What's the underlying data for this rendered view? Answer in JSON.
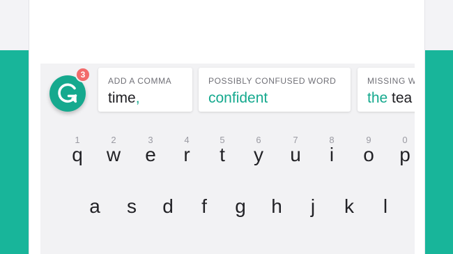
{
  "grammarly": {
    "logo_letter": "G",
    "badge_count": "3",
    "brand_color": "#15a98e",
    "badge_color": "#f26b6b"
  },
  "suggestions": [
    {
      "title": "ADD A COMMA",
      "text_before": "time",
      "accent": ",",
      "text_after": ""
    },
    {
      "title": "POSSIBLY CONFUSED WORD",
      "text_before": "",
      "accent": "confident",
      "text_after": ""
    },
    {
      "title": "MISSING W",
      "text_before": "",
      "accent": "the",
      "text_after": " tea"
    }
  ],
  "keyboard": {
    "digits": [
      "1",
      "2",
      "3",
      "4",
      "5",
      "6",
      "7",
      "8",
      "9",
      "0"
    ],
    "row1": [
      "q",
      "w",
      "e",
      "r",
      "t",
      "y",
      "u",
      "i",
      "o",
      "p"
    ],
    "row2": [
      "a",
      "s",
      "d",
      "f",
      "g",
      "h",
      "j",
      "k",
      "l"
    ]
  }
}
